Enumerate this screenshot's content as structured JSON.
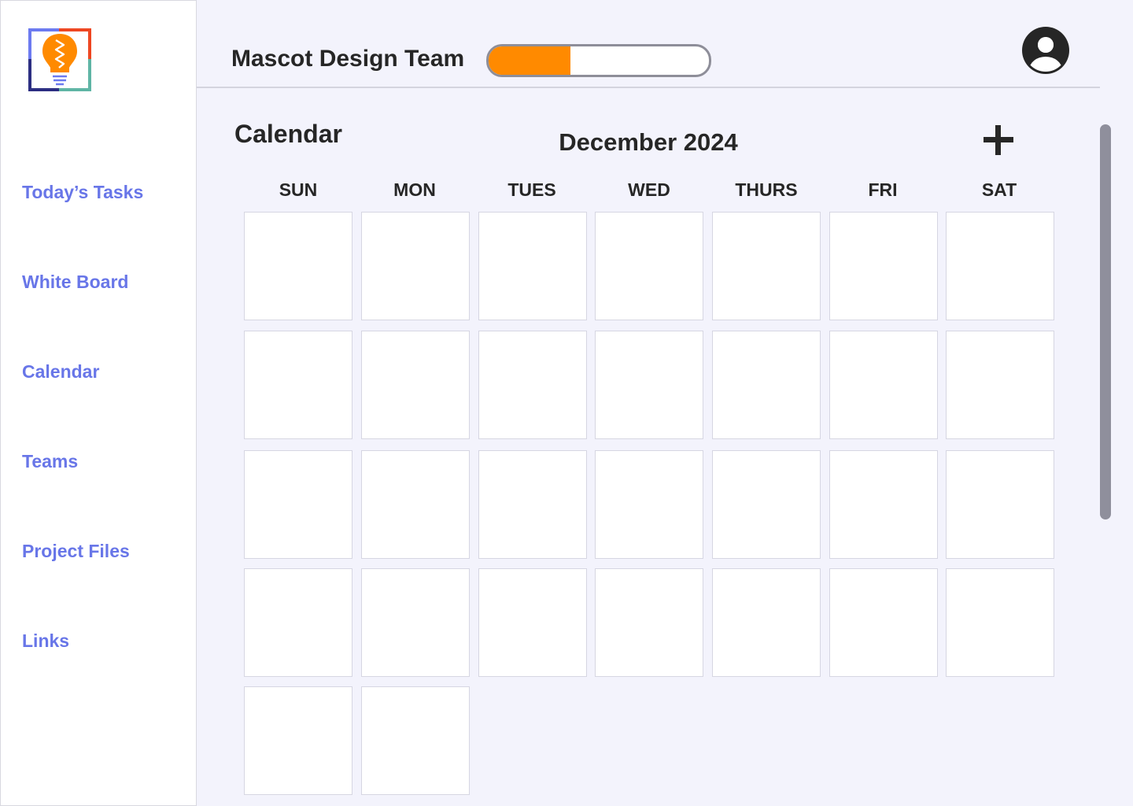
{
  "sidebar": {
    "logo": "lightbulb-logo",
    "items": [
      {
        "label": "Today’s Tasks"
      },
      {
        "label": "White Board"
      },
      {
        "label": "Calendar"
      },
      {
        "label": "Teams"
      },
      {
        "label": "Project Files"
      },
      {
        "label": "Links"
      }
    ]
  },
  "header": {
    "team_name": "Mascot Design Team",
    "progress_percent": 37,
    "avatar_icon": "user-avatar-icon"
  },
  "calendar": {
    "section_title": "Calendar",
    "month_label": "December 2024",
    "add_icon": "plus-icon",
    "weekdays": [
      "SUN",
      "MON",
      "TUES",
      "WED",
      "THURS",
      "FRI",
      "SAT"
    ],
    "rows": 5,
    "cells_in_last_row": 2
  },
  "colors": {
    "accent": "#6876e8",
    "progress": "#ff8a00",
    "background": "#f3f3fc"
  }
}
